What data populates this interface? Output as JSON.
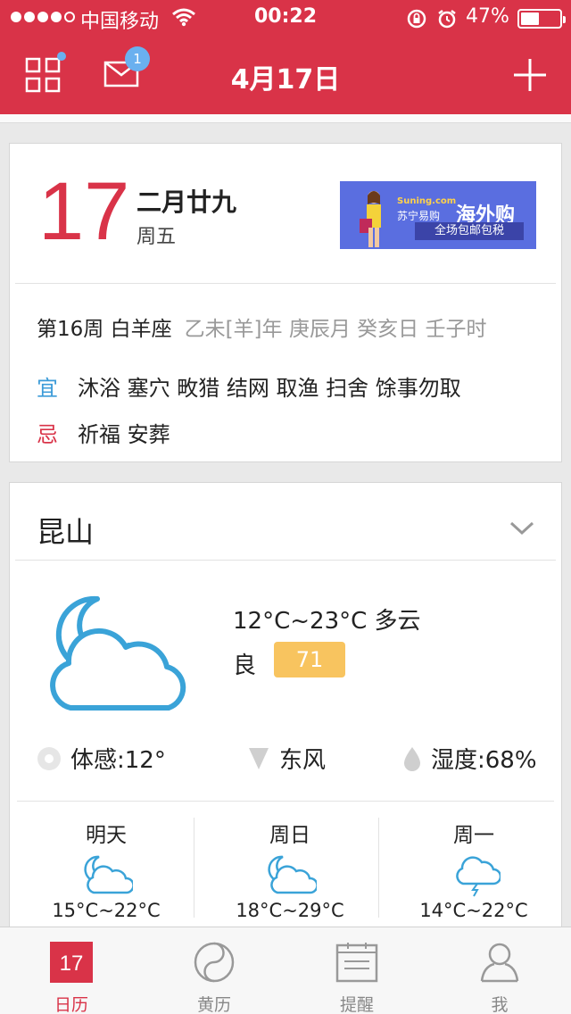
{
  "status": {
    "carrier": "中国移动",
    "time": "00:22",
    "battery_percent": "47%",
    "battery_level": 0.47
  },
  "header": {
    "title": "4月17日",
    "mail_badge": "1"
  },
  "calendar": {
    "day": "17",
    "lunar_date": "二月廿九",
    "weekday": "周五",
    "week_zodiac": "第16周 白羊座",
    "ganzhi": "乙未[羊]年 庚辰月 癸亥日 壬子时",
    "yi_label": "宜",
    "yi_items": "沐浴 塞穴 畋猎 结网 取渔 扫舍 馀事勿取",
    "ji_label": "忌",
    "ji_items": "祈福 安葬",
    "ad": {
      "brand": "Suning",
      "brand_suffix": ".com",
      "brand_cn": "苏宁易购",
      "headline": "海外购",
      "strip": "全场包邮包税"
    }
  },
  "weather": {
    "city": "昆山",
    "temp_range": "12°C~23°C 多云",
    "aqi_label": "良",
    "aqi_value": "71",
    "feels_like": "体感:12°",
    "wind": "东风",
    "humidity": "湿度:68%",
    "forecast": [
      {
        "day": "明天",
        "range": "15°C~22°C",
        "icon": "partly-cloudy-night-icon"
      },
      {
        "day": "周日",
        "range": "18°C~29°C",
        "icon": "partly-cloudy-night-icon"
      },
      {
        "day": "周一",
        "range": "14°C~22°C",
        "icon": "thunderstorm-icon"
      }
    ]
  },
  "tabs": [
    {
      "label": "日历",
      "icon": "calendar-icon",
      "icon_text": "17",
      "active": true
    },
    {
      "label": "黄历",
      "icon": "taiji-icon",
      "active": false
    },
    {
      "label": "提醒",
      "icon": "reminder-icon",
      "active": false
    },
    {
      "label": "我",
      "icon": "user-icon",
      "active": false
    }
  ],
  "colors": {
    "brand_red": "#d93348",
    "accent_blue": "#3c9bd8",
    "aqi_yellow": "#f8c45f",
    "badge_blue": "#6ab0ef"
  }
}
